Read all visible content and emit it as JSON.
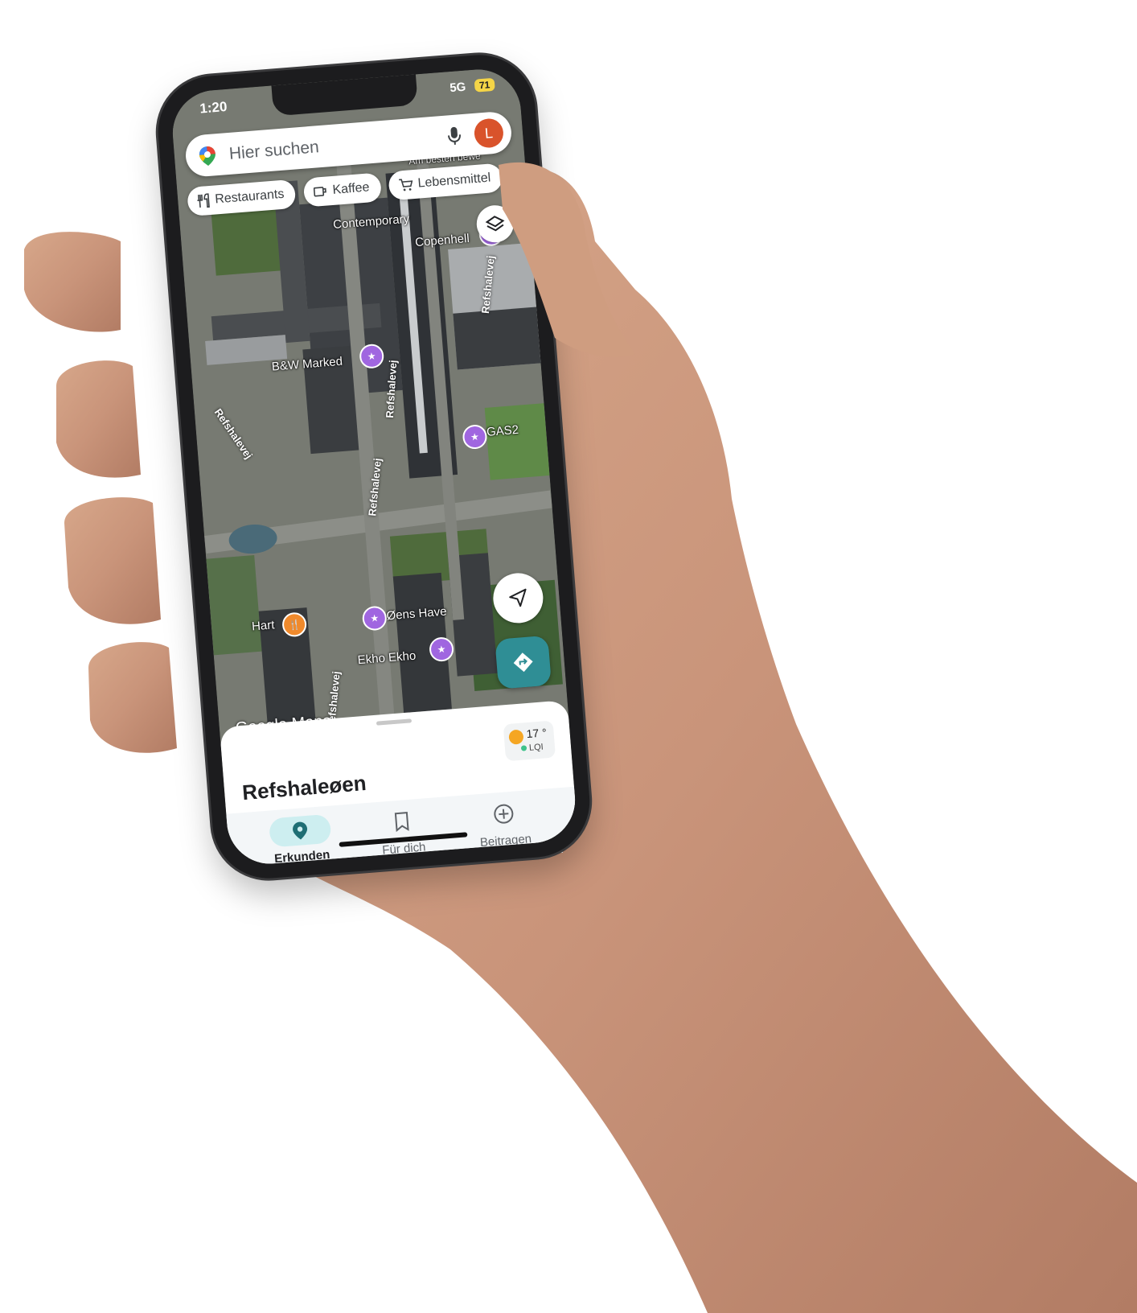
{
  "status_bar": {
    "time": "1:20",
    "network": "5G",
    "battery": "71"
  },
  "search": {
    "placeholder": "Hier suchen",
    "avatar_letter": "L"
  },
  "chips": [
    {
      "label": "Restaurants",
      "icon": "fork-knife-icon"
    },
    {
      "label": "Kaffee",
      "icon": "coffee-icon"
    },
    {
      "label": "Lebensmittel",
      "icon": "cart-icon"
    }
  ],
  "map": {
    "watermark": "Google Maps",
    "labels": {
      "contemporary": "Contemporary",
      "copenhell": "Copenhell",
      "bw_marked": "B&W Marked",
      "gas2": "GAS2",
      "hart": "Hart",
      "oens_have": "Øens Have",
      "ekho_ekho": "Ekho Ekho",
      "am_besten": "Am besten bewe"
    },
    "roads": {
      "refshalevej": "Refshalevej"
    }
  },
  "sheet": {
    "title": "Refshaleøen",
    "weather": {
      "temp": "17 °",
      "aqi": "LQI"
    }
  },
  "nav": {
    "explore": "Erkunden",
    "for_you": "Für dich",
    "contribute": "Beitragen"
  },
  "colors": {
    "accent": "#2f8e95",
    "avatar": "#d9532b",
    "poi_purple": "#a066e0",
    "poi_orange": "#f08a2c"
  }
}
